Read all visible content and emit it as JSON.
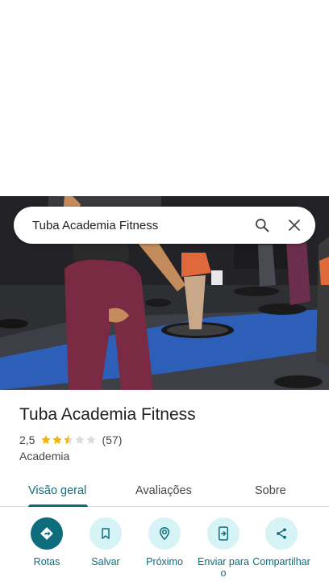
{
  "search": {
    "query": "Tuba Academia Fitness"
  },
  "place": {
    "name": "Tuba Academia Fitness",
    "rating": "2,5",
    "rating_value": 2.5,
    "review_count": "(57)",
    "category": "Academia"
  },
  "tabs": [
    {
      "label": "Visão geral",
      "active": true
    },
    {
      "label": "Avaliações",
      "active": false
    },
    {
      "label": "Sobre",
      "active": false
    }
  ],
  "actions": [
    {
      "label": "Rotas",
      "icon": "directions-icon"
    },
    {
      "label": "Salvar",
      "icon": "bookmark-icon"
    },
    {
      "label": "Próximo",
      "icon": "nearby-icon"
    },
    {
      "label": "Enviar para o",
      "icon": "send-to-phone-icon"
    },
    {
      "label": "Compartilhar",
      "icon": "share-icon"
    }
  ],
  "colors": {
    "accent": "#0e6d7c",
    "accent_light": "#d6f3f6",
    "star": "#f4b400",
    "star_empty": "#dadce0"
  }
}
